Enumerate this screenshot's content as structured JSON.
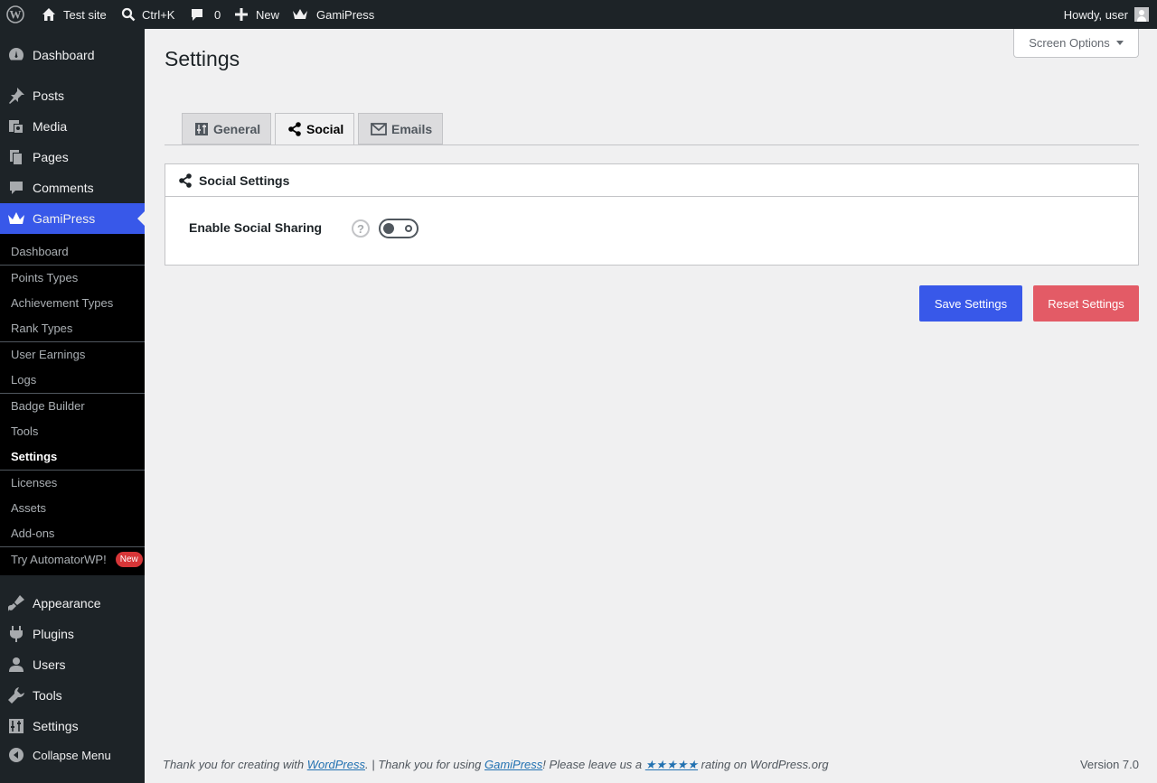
{
  "admin_bar": {
    "site_name": "Test site",
    "search_shortcut": "Ctrl+K",
    "comments_count": "0",
    "new_label": "New",
    "plugin_label": "GamiPress",
    "greeting": "Howdy, user"
  },
  "menu": {
    "dashboard": "Dashboard",
    "posts": "Posts",
    "media": "Media",
    "pages": "Pages",
    "comments": "Comments",
    "gamipress": "GamiPress",
    "appearance": "Appearance",
    "plugins": "Plugins",
    "users": "Users",
    "tools": "Tools",
    "settings": "Settings",
    "collapse": "Collapse Menu"
  },
  "submenu": {
    "items": [
      "Dashboard",
      "Points Types",
      "Achievement Types",
      "Rank Types",
      "User Earnings",
      "Logs",
      "Badge Builder",
      "Tools",
      "Settings",
      "Licenses",
      "Assets",
      "Add-ons",
      "Try AutomatorWP!"
    ],
    "new_badge": "New",
    "active": "Settings"
  },
  "screen_options": "Screen Options",
  "page_title": "Settings",
  "tabs": [
    {
      "label": "General",
      "icon": "settings-icon"
    },
    {
      "label": "Social",
      "icon": "share-icon",
      "active": true
    },
    {
      "label": "Emails",
      "icon": "email-icon"
    }
  ],
  "section": {
    "title": "Social Settings",
    "field_label": "Enable Social Sharing",
    "help": "?",
    "toggle_on": false
  },
  "buttons": {
    "save": "Save Settings",
    "reset": "Reset Settings"
  },
  "footer": {
    "text1": "Thank you for creating with ",
    "link1": "WordPress",
    "text2": ". | Thank you for using ",
    "link2": "GamiPress",
    "text3": "! Please leave us a ",
    "stars": "★★★★★",
    "text4": " rating on WordPress.org",
    "version": "Version 7.0"
  },
  "colors": {
    "accent": "#3858e9",
    "danger": "#e35b66",
    "admin_bg": "#1d2327"
  }
}
